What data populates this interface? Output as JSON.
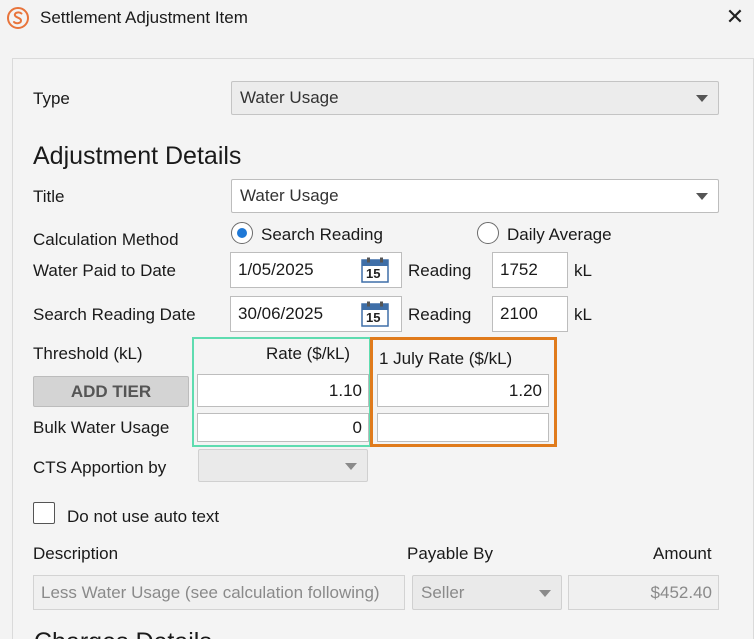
{
  "window": {
    "title": "Settlement Adjustment Item",
    "close_glyph": "✕",
    "app_icon": "app-logo-icon",
    "brand_color": "#e8743b"
  },
  "form": {
    "type_label": "Type",
    "type_value": "Water Usage",
    "section_heading": "Adjustment Details",
    "title_label": "Title",
    "title_value": "Water Usage",
    "calc_method_label": "Calculation Method",
    "calc_option_1": "Search Reading",
    "calc_option_2": "Daily Average",
    "calc_selected": "Search Reading",
    "water_paid_label": "Water Paid to Date",
    "water_paid_date": "1/05/2025",
    "reading_label_1": "Reading",
    "reading_value_1": "1752",
    "unit_1": "kL",
    "search_date_label": "Search Reading Date",
    "search_date_value": "30/06/2025",
    "reading_label_2": "Reading",
    "reading_value_2": "2100",
    "unit_2": "kL",
    "calendar_day": "15",
    "threshold_label": "Threshold (kL)",
    "rate_header": "Rate ($/kL)",
    "july_rate_header": "1 July Rate ($/kL)",
    "add_tier_label": "ADD TIER",
    "rate_value": "1.10",
    "july_rate_value": "1.20",
    "bulk_label": "Bulk Water Usage",
    "bulk_rate_value": "0",
    "bulk_july_value": "",
    "cts_label": "CTS Apportion by",
    "cts_value": "",
    "auto_text_label": "Do not use auto text",
    "description_header": "Description",
    "payable_header": "Payable By",
    "amount_header": "Amount",
    "description_value": "Less Water Usage (see calculation following)",
    "payable_value": "Seller",
    "amount_value": "$452.40",
    "next_section_heading": "Charges Details",
    "highlight_green": "#5fdcb0",
    "highlight_orange": "#e07b1c"
  }
}
